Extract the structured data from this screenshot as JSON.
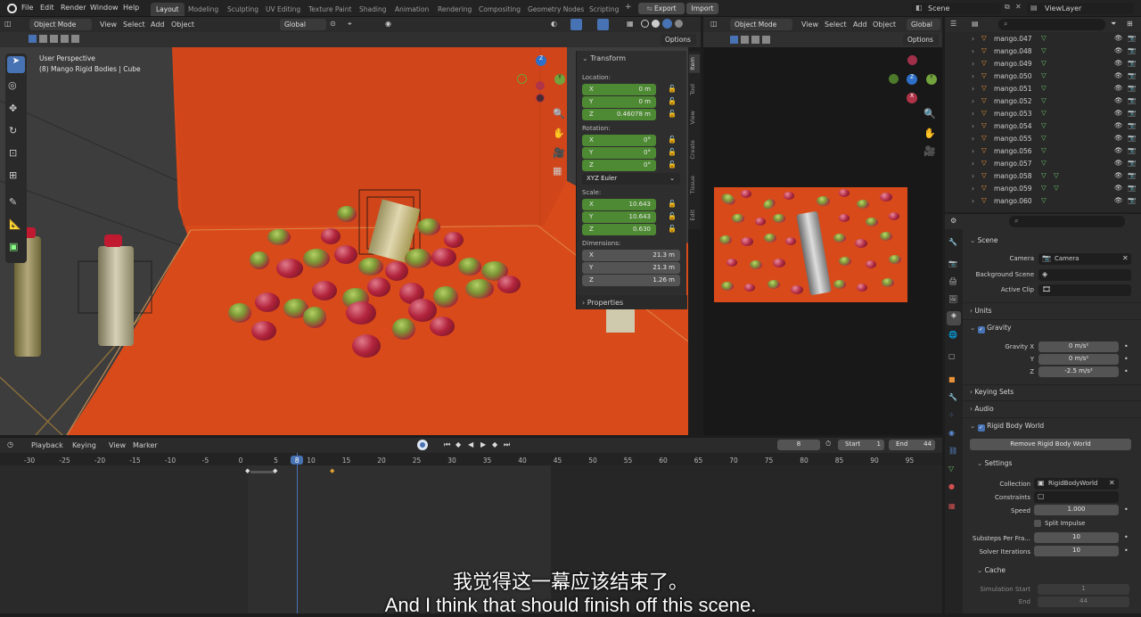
{
  "menus": [
    "File",
    "Edit",
    "Render",
    "Window",
    "Help"
  ],
  "workspaces": [
    "Layout",
    "Modeling",
    "Sculpting",
    "UV Editing",
    "Texture Paint",
    "Shading",
    "Animation",
    "Rendering",
    "Compositing",
    "Geometry Nodes",
    "Scripting"
  ],
  "top_buttons": {
    "export": "Export",
    "import": "Import",
    "scene": "Scene",
    "view_layer": "ViewLayer"
  },
  "viewport": {
    "mode": "Object Mode",
    "menu": [
      "View",
      "Select",
      "Add",
      "Object"
    ],
    "orientation": "Global",
    "options": "Options",
    "perspective": "User Perspective",
    "active_object": "(8) Mango Rigid Bodies | Cube"
  },
  "npanel": {
    "header": "Transform",
    "location_label": "Location:",
    "location": [
      {
        "axis": "X",
        "value": "0 m"
      },
      {
        "axis": "Y",
        "value": "0 m"
      },
      {
        "axis": "Z",
        "value": "0.46078 m"
      }
    ],
    "rotation_label": "Rotation:",
    "rotation": [
      {
        "axis": "X",
        "value": "0°"
      },
      {
        "axis": "Y",
        "value": "0°"
      },
      {
        "axis": "Z",
        "value": "0°"
      }
    ],
    "euler": "XYZ Euler",
    "scale_label": "Scale:",
    "scale": [
      {
        "axis": "X",
        "value": "10.643"
      },
      {
        "axis": "Y",
        "value": "10.643"
      },
      {
        "axis": "Z",
        "value": "0.630"
      }
    ],
    "dimensions_label": "Dimensions:",
    "dimensions": [
      {
        "axis": "X",
        "value": "21.3 m"
      },
      {
        "axis": "Y",
        "value": "21.3 m"
      },
      {
        "axis": "Z",
        "value": "1.26 m"
      }
    ],
    "properties": "Properties",
    "tabs": [
      "Item",
      "Tool",
      "View",
      "Create",
      "Tissue",
      "Edit"
    ]
  },
  "viewport2": {
    "mode": "Object Mode",
    "menu": [
      "View",
      "Select",
      "Add",
      "Object"
    ],
    "orientation": "Global",
    "options": "Options"
  },
  "outliner": {
    "items": [
      "mango.047",
      "mango.048",
      "mango.049",
      "mango.050",
      "mango.051",
      "mango.052",
      "mango.053",
      "mango.054",
      "mango.055",
      "mango.056",
      "mango.057",
      "mango.058",
      "mango.059",
      "mango.060"
    ]
  },
  "properties": {
    "scene_header": "Scene",
    "camera_label": "Camera",
    "camera_value": "Camera",
    "background_scene_label": "Background Scene",
    "active_clip_label": "Active Clip",
    "units": "Units",
    "gravity": "Gravity",
    "gravity_x_label": "Gravity X",
    "gravity_x": "0 m/s²",
    "gravity_y_label": "Y",
    "gravity_y": "0 m/s²",
    "gravity_z_label": "Z",
    "gravity_z": "-2.5 m/s²",
    "keying_sets": "Keying Sets",
    "audio": "Audio",
    "rigid_body_world": "Rigid Body World",
    "remove_button": "Remove Rigid Body World",
    "settings": "Settings",
    "collection_label": "Collection",
    "collection_value": "RigidBodyWorld",
    "constraints_label": "Constraints",
    "speed_label": "Speed",
    "speed_value": "1.000",
    "split_impulse": "Split Impulse",
    "substeps_label": "Substeps Per Fra...",
    "substeps_value": "10",
    "solver_label": "Solver Iterations",
    "solver_value": "10",
    "cache": "Cache",
    "sim_start_label": "Simulation Start",
    "sim_start_value": "1",
    "end_label": "End",
    "end_value": "44"
  },
  "timeline": {
    "menu": [
      "Playback",
      "Keying",
      "View",
      "Marker"
    ],
    "current_frame": "8",
    "start_label": "Start",
    "start": "1",
    "end_label": "End",
    "end": "44",
    "ticks": [
      "-30",
      "-25",
      "-20",
      "-15",
      "-10",
      "-5",
      "0",
      "5",
      "8",
      "10",
      "15",
      "20",
      "25",
      "30",
      "35",
      "40",
      "45",
      "50",
      "55",
      "60",
      "65",
      "70",
      "75",
      "80",
      "85",
      "90",
      "95"
    ]
  },
  "subtitles": {
    "zh": "我觉得这一幕应该结束了。",
    "en": "And I think that should finish off this scene."
  },
  "colors": {
    "accent": "#4772b3",
    "field_green": "#4e8a33",
    "backdrop": "#d94a1a"
  }
}
